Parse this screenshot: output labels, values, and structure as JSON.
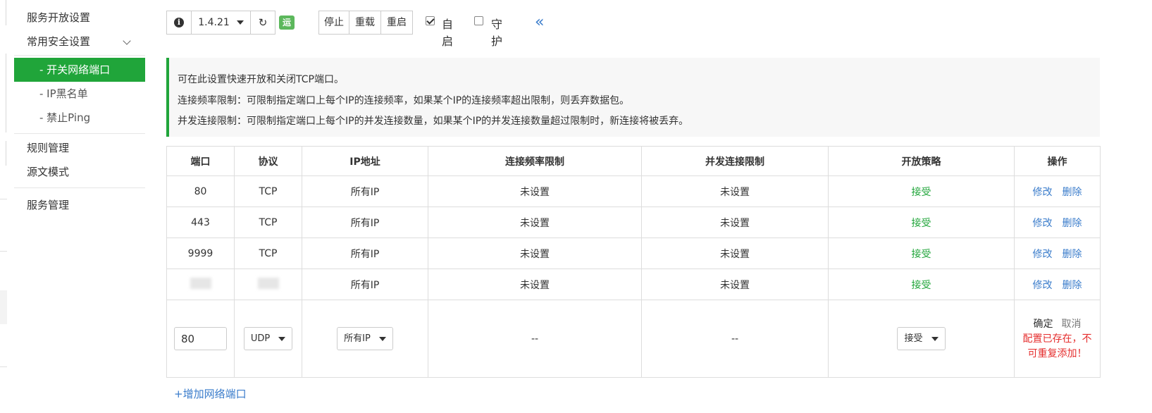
{
  "sidebar": {
    "items": [
      {
        "label": "服务开放设置"
      },
      {
        "label": "常用安全设置"
      },
      {
        "label": "规则管理"
      },
      {
        "label": "源文模式"
      },
      {
        "label": "服务管理"
      }
    ],
    "sub_items": [
      {
        "label": "- 开关网络端口",
        "active": true
      },
      {
        "label": "- IP黑名单"
      },
      {
        "label": "- 禁止Ping"
      }
    ]
  },
  "toolbar": {
    "info_icon": "i",
    "version": "1.4.21",
    "refresh_icon": "↻",
    "status": "运行中",
    "stop": "停止",
    "reload": "重载",
    "restart": "重启",
    "autostart_label": "自启",
    "autostart_checked": true,
    "guard_label": "守护",
    "guard_checked": false,
    "collapse_icon": "«"
  },
  "info": {
    "line1": "可在此设置快速开放和关闭TCP端口。",
    "line2": "连接频率限制：可限制指定端口上每个IP的连接频率，如果某个IP的连接频率超出限制，则丢弃数据包。",
    "line3": "并发连接限制：可限制指定端口上每个IP的并发连接数量，如果某个IP的并发连接数量超过限制时，新连接将被丢弃。"
  },
  "table": {
    "headers": [
      "端口",
      "协议",
      "IP地址",
      "连接频率限制",
      "并发连接限制",
      "开放策略",
      "操作"
    ],
    "rows": [
      {
        "port": "80",
        "protocol": "TCP",
        "ip": "所有IP",
        "rate": "未设置",
        "concurrent": "未设置",
        "policy": "接受"
      },
      {
        "port": "443",
        "protocol": "TCP",
        "ip": "所有IP",
        "rate": "未设置",
        "concurrent": "未设置",
        "policy": "接受"
      },
      {
        "port": "9999",
        "protocol": "TCP",
        "ip": "所有IP",
        "rate": "未设置",
        "concurrent": "未设置",
        "policy": "接受"
      },
      {
        "port": "",
        "protocol": "",
        "ip": "所有IP",
        "rate": "未设置",
        "concurrent": "未设置",
        "policy": "接受"
      }
    ],
    "edit_label": "修改",
    "delete_label": "删除",
    "edit_row": {
      "port_value": "80",
      "protocol": "UDP",
      "ip": "所有IP",
      "rate": "--",
      "concurrent": "--",
      "policy": "接受",
      "confirm": "确定",
      "cancel": "取消",
      "error": "配置已存在，不可重复添加！"
    }
  },
  "add_link": "+增加网络端口",
  "colors": {
    "accent": "#20a53a",
    "link": "#3a7ccb",
    "error": "#e52d2d"
  }
}
